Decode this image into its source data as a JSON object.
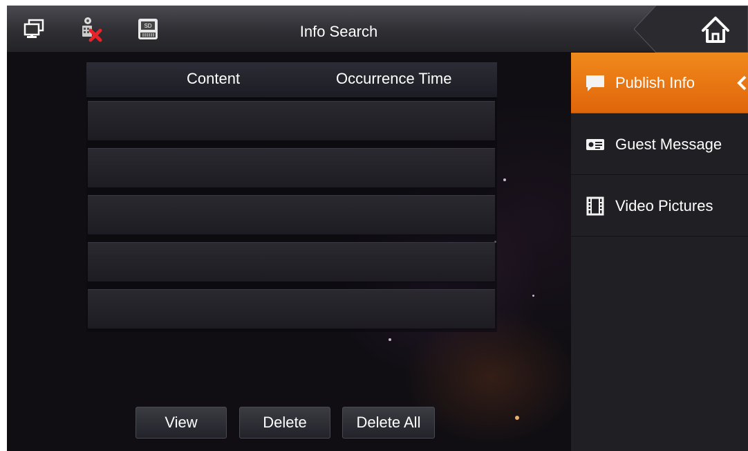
{
  "header": {
    "title": "Info Search",
    "status_icons": [
      "monitor-icon",
      "camera-disconnected-icon",
      "sd-card-icon"
    ],
    "home_icon": "home-icon"
  },
  "table": {
    "columns": [
      "Content",
      "Occurrence Time"
    ],
    "rows": [
      {
        "content": "",
        "time": ""
      },
      {
        "content": "",
        "time": ""
      },
      {
        "content": "",
        "time": ""
      },
      {
        "content": "",
        "time": ""
      },
      {
        "content": "",
        "time": ""
      }
    ]
  },
  "actions": {
    "view_label": "View",
    "delete_label": "Delete",
    "delete_all_label": "Delete All"
  },
  "sidebar": {
    "items": [
      {
        "label": "Publish Info",
        "icon": "speech-bubble-icon",
        "active": true
      },
      {
        "label": "Guest Message",
        "icon": "message-card-icon",
        "active": false
      },
      {
        "label": "Video Pictures",
        "icon": "film-icon",
        "active": false
      }
    ]
  },
  "colors": {
    "accent": "#f07d14",
    "background": "#100e13",
    "sidebar": "#202024"
  }
}
